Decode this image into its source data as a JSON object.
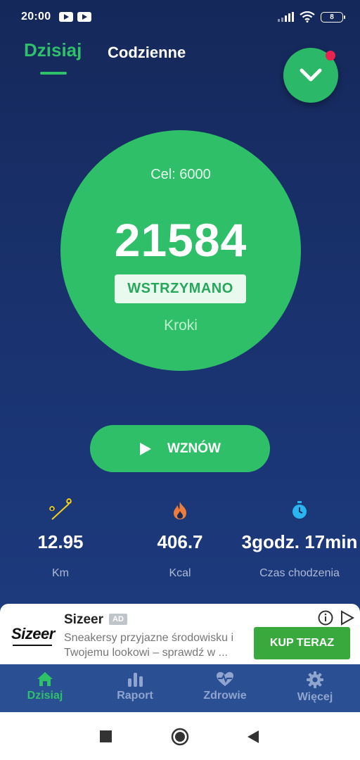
{
  "status_bar": {
    "time": "20:00",
    "battery": "8",
    "icons": [
      "youtube-icon",
      "youtube-icon",
      "signal-icon",
      "wifi-icon",
      "battery-icon"
    ]
  },
  "tabs": [
    {
      "label": "Dzisiaj",
      "active": true
    },
    {
      "label": "Codzienne",
      "active": false
    }
  ],
  "fab": {
    "icon": "chevron-down-icon",
    "notification_dot_color": "#e8234f"
  },
  "goal": {
    "label": "Cel: 6000",
    "steps": "21584",
    "status": "WSTRZYMANO",
    "unit": "Kroki"
  },
  "resume_button": {
    "label": "WZNÓW",
    "icon": "play-icon"
  },
  "stats": [
    {
      "icon": "map-pins-icon",
      "value": "12.95",
      "label": "Km"
    },
    {
      "icon": "flame-icon",
      "value": "406.7",
      "label": "Kcal"
    },
    {
      "icon": "stopwatch-icon",
      "value": "3godz. 17min",
      "label": "Czas chodzenia"
    }
  ],
  "ad": {
    "logo": "Sizeer",
    "title": "Sizeer",
    "badge": "AD",
    "text": "Sneakersy przyjazne środowisku i Twojemu lookowi – sprawdź w ...",
    "cta": "KUP TERAZ"
  },
  "bottom_nav": [
    {
      "icon": "home-icon",
      "label": "Dzisiaj",
      "active": true
    },
    {
      "icon": "bar-chart-icon",
      "label": "Raport",
      "active": false
    },
    {
      "icon": "heart-pulse-icon",
      "label": "Zdrowie",
      "active": false
    },
    {
      "icon": "gear-icon",
      "label": "Więcej",
      "active": false
    }
  ],
  "colors": {
    "accent": "#2fbf69",
    "background_top": "#15285a",
    "background_bottom": "#1d3e84",
    "nav_bg": "#2a4f93",
    "cta": "#3aa93d"
  }
}
